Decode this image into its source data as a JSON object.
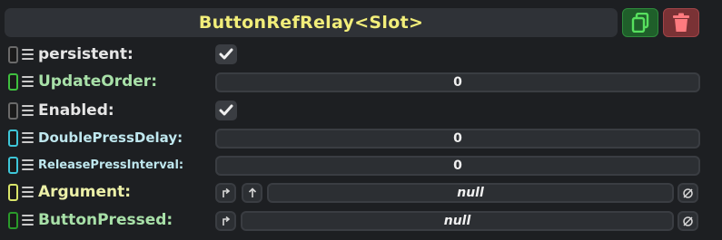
{
  "header": {
    "title": "ButtonRefRelay<Slot>"
  },
  "icons": {
    "duplicate": "duplicate-icon",
    "delete": "trash-icon"
  },
  "colors": {
    "title": "#f2ee7a",
    "duplicate_bg": "#1f5f2a",
    "delete_bg": "#7a3235",
    "label_green": "#a8e0a8",
    "label_cyan": "#bfe7ee",
    "label_yellow": "#ecf0a8"
  },
  "fields": {
    "persistent": {
      "label": "persistent:",
      "checked": true
    },
    "update_order": {
      "label": "UpdateOrder:",
      "value": "0"
    },
    "enabled": {
      "label": "Enabled:",
      "checked": true
    },
    "double_press_delay": {
      "label": "DoublePressDelay:",
      "value": "0"
    },
    "release_press_interval": {
      "label": "ReleasePressInterval:",
      "value": "0"
    },
    "argument": {
      "label": "Argument:",
      "value": "null"
    },
    "button_pressed": {
      "label": "ButtonPressed:",
      "value": "null"
    }
  }
}
